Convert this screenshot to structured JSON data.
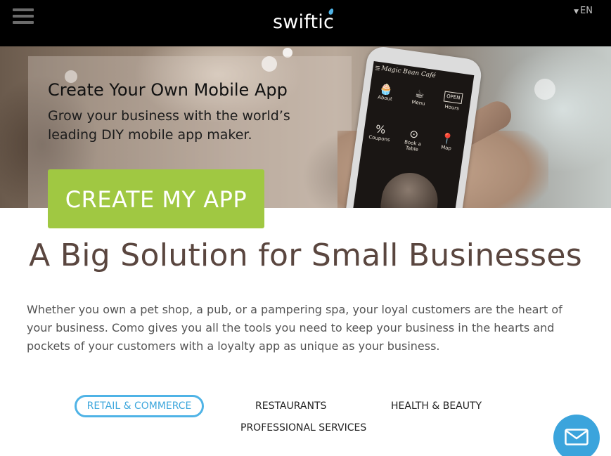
{
  "header": {
    "logo_text": "swiftic",
    "lang_label": "EN",
    "icons": {
      "menu": "hamburger-icon",
      "lang": "chevron-down-icon"
    }
  },
  "hero": {
    "title": "Create Your Own Mobile App",
    "subtitle": "Grow your business with the world’s leading DIY mobile app maker.",
    "cta_label": "CREATE MY APP",
    "phone": {
      "app_name": "Magic Bean Café",
      "menu_glyph": "☰",
      "icons": [
        {
          "label": "About",
          "icon": "cupcake-icon",
          "glyph": "🧁"
        },
        {
          "label": "Menu",
          "icon": "coffee-cup-icon",
          "glyph": "☕"
        },
        {
          "label": "Hours",
          "icon": "open-sign-icon",
          "glyph": "OPEN"
        },
        {
          "label": "Coupons",
          "icon": "coupon-icon",
          "glyph": "%"
        },
        {
          "label": "Book a Table",
          "icon": "plate-icon",
          "glyph": "⊙"
        },
        {
          "label": "Map",
          "icon": "map-pin-icon",
          "glyph": "📍"
        }
      ]
    }
  },
  "main": {
    "headline": "A Big Solution for Small Businesses",
    "body": "Whether you own a pet shop, a pub, or a pampering spa, your loyal customers are the heart of your business. Como gives you all the tools you need to keep your business in the hearts and pockets of your customers with a loyalty app as unique as your business.",
    "tabs": [
      {
        "label": "RETAIL & COMMERCE",
        "active": true
      },
      {
        "label": "RESTAURANTS",
        "active": false
      },
      {
        "label": "HEALTH & BEAUTY",
        "active": false
      },
      {
        "label": "PROFESSIONAL SERVICES",
        "active": false
      }
    ]
  },
  "floating": {
    "icon": "mail-envelope-icon"
  },
  "colors": {
    "accent_green": "#a0c842",
    "accent_blue": "#3ba4dc",
    "headline_brown": "#5a463f",
    "header_bg": "#000000"
  }
}
